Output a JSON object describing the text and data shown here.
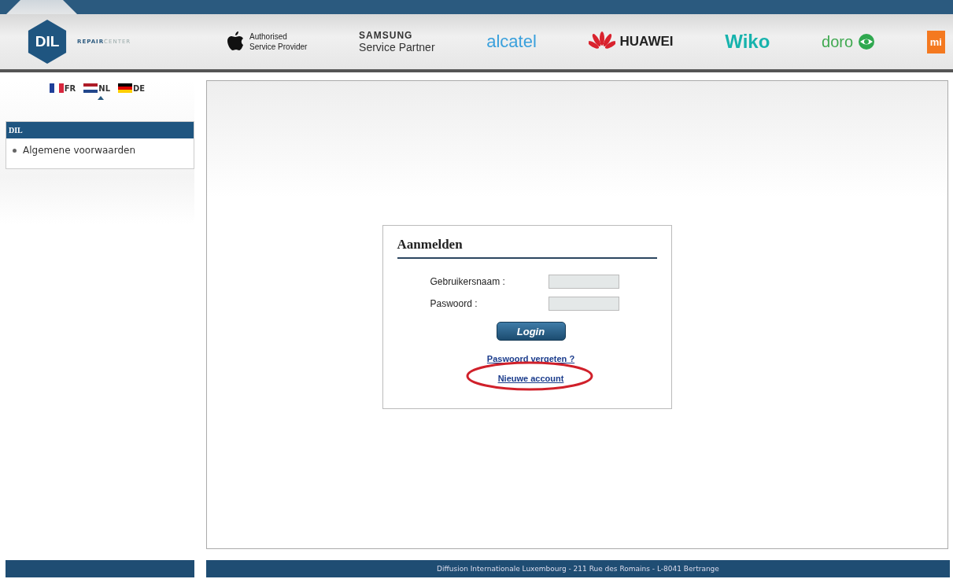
{
  "header": {
    "logo": {
      "mark": "DIL",
      "tagline_bold": "REPAIR",
      "tagline_light": "CENTER"
    },
    "partners": [
      {
        "kind": "apple",
        "lines": [
          "Authorised",
          "Service Provider"
        ]
      },
      {
        "kind": "samsung",
        "lines": [
          "SAMSUNG",
          "Service Partner"
        ]
      },
      {
        "kind": "alcatel",
        "lines": [
          "alcatel"
        ]
      },
      {
        "kind": "huawei",
        "lines": [
          "HUAWEI"
        ]
      },
      {
        "kind": "wiko",
        "lines": [
          "Wiko"
        ]
      },
      {
        "kind": "doro",
        "lines": [
          "doro"
        ]
      },
      {
        "kind": "mi",
        "lines": [
          "mi"
        ]
      }
    ]
  },
  "languages": [
    {
      "code": "FR",
      "kind": "fr",
      "selected": false
    },
    {
      "code": "NL",
      "kind": "nl",
      "selected": true
    },
    {
      "code": "DE",
      "kind": "de",
      "selected": false
    }
  ],
  "sidebar": {
    "title": "DIL",
    "items": [
      {
        "label": "Algemene voorwaarden"
      }
    ]
  },
  "login": {
    "title": "Aanmelden",
    "fields": [
      {
        "label": "Gebruikersnaam :"
      },
      {
        "label": "Paswoord :"
      }
    ],
    "button": "Login",
    "links": [
      {
        "label": "Paswoord vergeten ?",
        "highlighted": false
      },
      {
        "label": "Nieuwe account",
        "highlighted": true
      }
    ]
  },
  "footer": "Diffusion Internationale Luxembourg - 211 Rue des Romains - L-8041 Bertrange"
}
